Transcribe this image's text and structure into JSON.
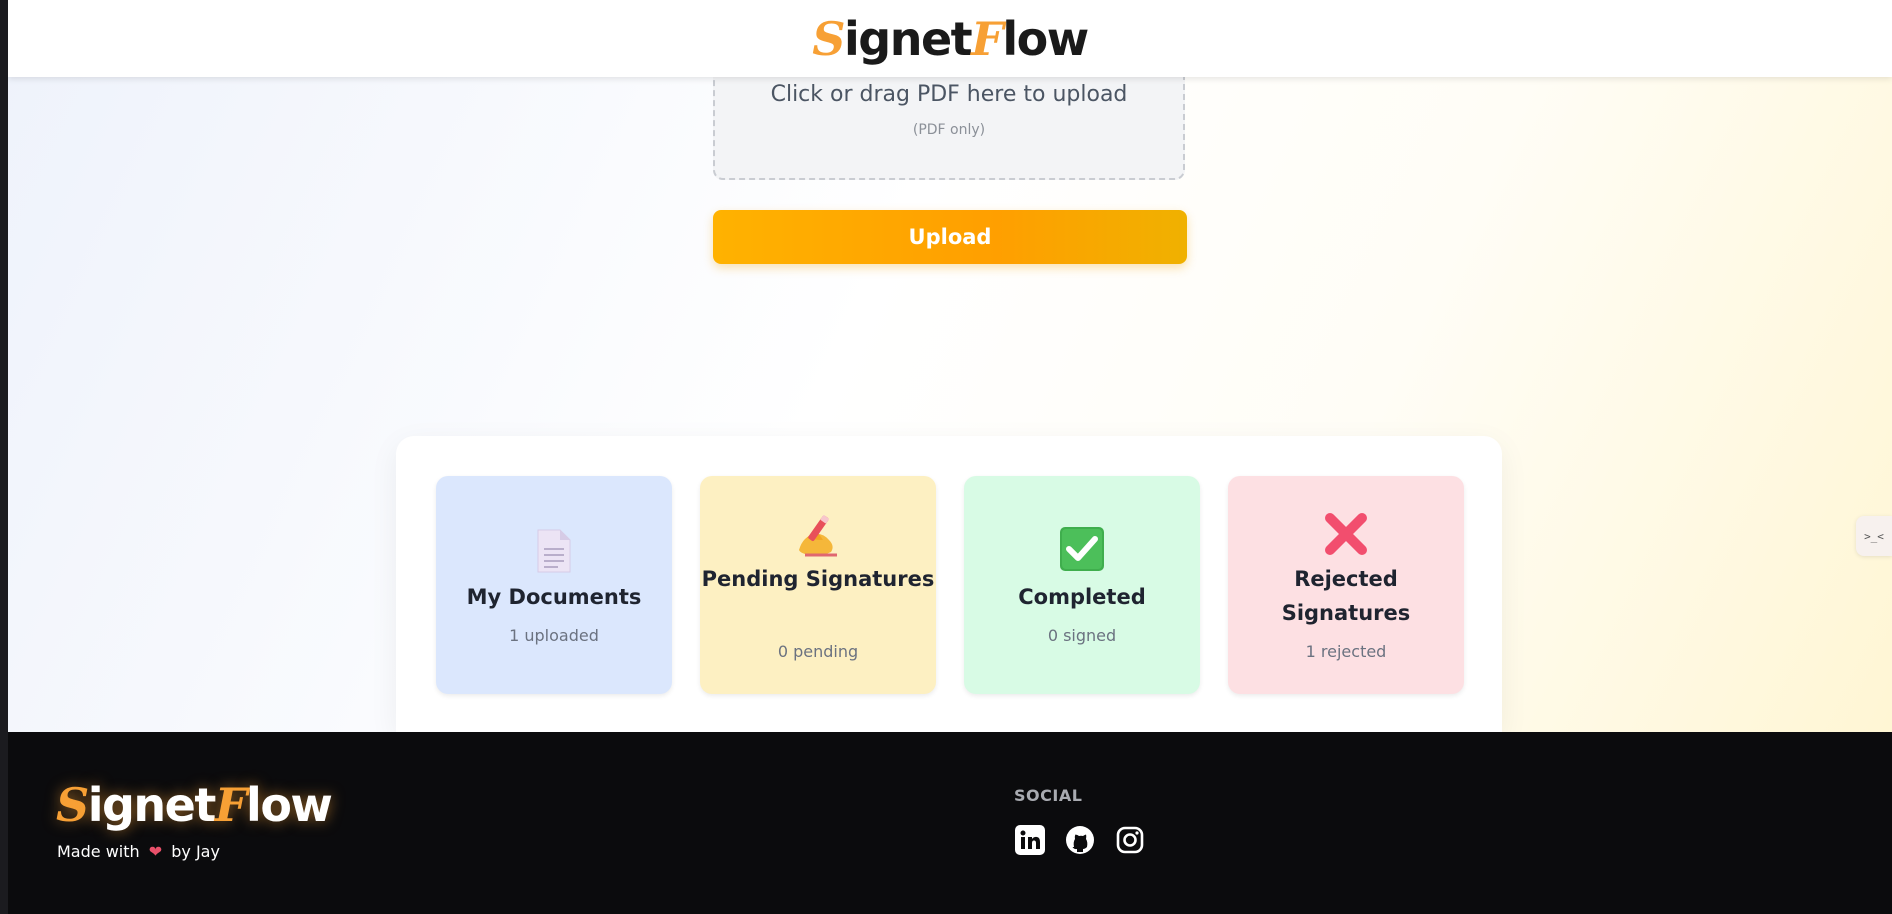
{
  "brand": {
    "name_first_letter": "S",
    "name_middle": "ignet",
    "name_second_letter": "F",
    "name_end": "low"
  },
  "upload": {
    "drop_text": "Click or drag PDF here to upload",
    "drop_hint": "(PDF only)",
    "button_label": "Upload"
  },
  "stats": [
    {
      "title": "My Documents",
      "count": "1 uploaded",
      "icon": "document-icon",
      "color": "#dbe7fd"
    },
    {
      "title": "Pending Signatures",
      "count": "0 pending",
      "icon": "writing-hand-icon",
      "color": "#fdf0c2"
    },
    {
      "title": "Completed",
      "count": "0 signed",
      "icon": "check-mark-icon",
      "color": "#d8fbe5"
    },
    {
      "title": "Rejected Signatures",
      "count": "1 rejected",
      "icon": "cross-mark-icon",
      "color": "#fde0e3"
    }
  ],
  "side_tab": {
    "label": ">_<"
  },
  "footer": {
    "made_with_prefix": "Made with",
    "heart": "❤",
    "made_with_suffix": "by Jay",
    "social_title": "SOCIAL",
    "social_icons": [
      "linkedin-icon",
      "github-icon",
      "instagram-icon"
    ]
  },
  "colors": {
    "accent": "#f7a035",
    "upload_button": "#ffa800",
    "footer_bg": "#0b0b0d"
  }
}
